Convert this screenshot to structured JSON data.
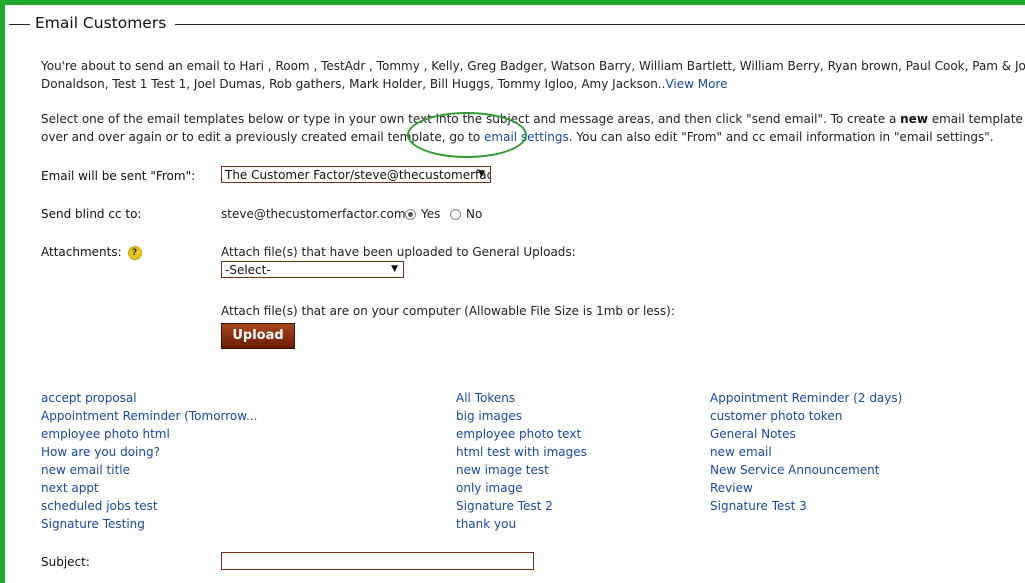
{
  "header": {
    "title": "Email Customers"
  },
  "intro": {
    "line1": "You're about to send an email to Hari , Room , TestAdr , Tommy , Kelly, Greg Badger, Watson Barry, William Bartlett, William Berry, Ryan brown, Paul Cook, Pam & John Dinkle, Jennifer",
    "line2": "Donaldson, Test 1 Test 1, Joel Dumas, Rob gathers, Mark Holder, Bill Huggs, Tommy Igloo, Amy Jackson..",
    "view_more": "View More"
  },
  "instructions": {
    "line1_a": "Select one of the email templates below or type in your own text into the subject and message areas, and then click \"send email\". To create a ",
    "line1_bold": "new",
    "line1_b": " email template that you can save an",
    "line2_a": "over and over again or to edit a previously created email template, go to ",
    "link": "email settings",
    "line2_b": ". You can also edit \"From\" and cc email information in \"email settings\"."
  },
  "from": {
    "label": "Email will be sent \"From\":",
    "value": "The Customer Factor/steve@thecustomerfactor.com"
  },
  "bcc": {
    "label": "Send blind cc to:",
    "email": "steve@thecustomerfactor.com",
    "yes": "Yes",
    "no": "No",
    "selected": "Yes"
  },
  "attachments": {
    "label": "Attachments:",
    "help": "?",
    "uploads_label": "Attach file(s) that have been uploaded to General Uploads:",
    "select_value": "-Select-",
    "computer_label": "Attach file(s) that are on your computer (Allowable File Size is 1mb or less):",
    "upload_button": "Upload"
  },
  "templates": {
    "col1": [
      "accept proposal",
      "Appointment Reminder (Tomorrow...",
      "employee photo html",
      "How are you doing?",
      "new email title",
      "next appt",
      "scheduled jobs test",
      "Signature Testing"
    ],
    "col2": [
      "All Tokens",
      "big images",
      "employee photo text",
      "html test with images",
      "new image test",
      "only image",
      "Signature Test 2",
      "thank you"
    ],
    "col3": [
      "Appointment Reminder (2 days)",
      "customer photo token",
      "General Notes",
      "new email",
      "New Service Announcement",
      "Review",
      "Signature Test 3"
    ]
  },
  "subject": {
    "label": "Subject:",
    "value": ""
  },
  "colors": {
    "frame": "#1faa2c",
    "link": "#1a48a8",
    "button": "#8b2f10"
  }
}
